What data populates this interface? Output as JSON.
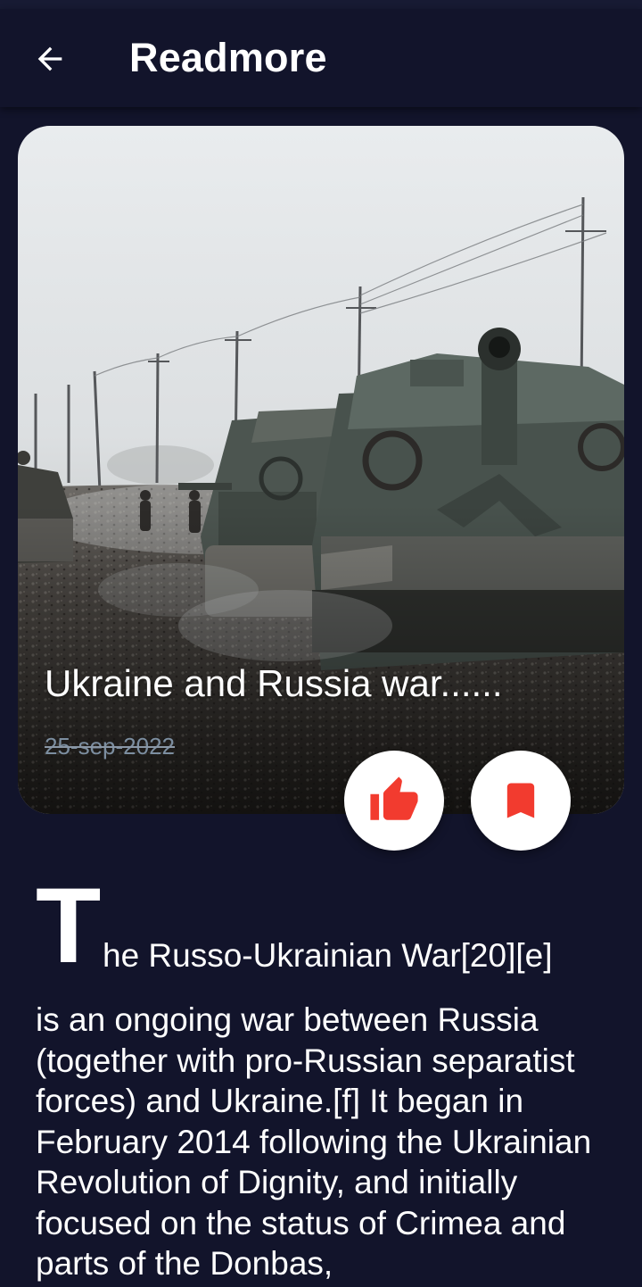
{
  "appbar": {
    "title": "Readmore",
    "back_icon": "arrow-left-icon"
  },
  "hero": {
    "image_description_icon": "war-photo",
    "title": "Ukraine and Russia war......",
    "date": "25-sep-2022"
  },
  "actions": {
    "like_icon": "thumbs-up-icon",
    "bookmark_icon": "bookmark-icon",
    "accent_color": "#f23b2f"
  },
  "article": {
    "drop_cap": "T",
    "first_line": "he Russo-Ukrainian War[20][e]",
    "body": "is an ongoing war between Russia (together with pro-Russian separatist forces) and Ukraine.[f] It began in February 2014 following the Ukrainian Revolution of Dignity, and initially focused on the status of Crimea and parts of the Donbas,"
  },
  "colors": {
    "background": "#12142b",
    "text": "#ffffff",
    "date_text": "#7c8ea0"
  }
}
